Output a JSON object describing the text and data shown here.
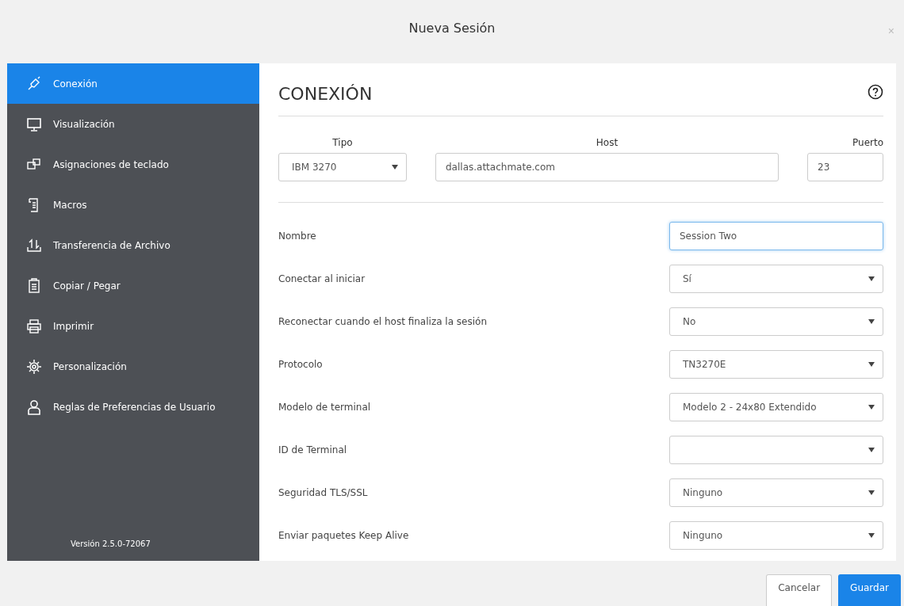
{
  "window": {
    "title": "Nueva Sesión",
    "close": "×"
  },
  "sidebar": {
    "items": [
      {
        "label": "Conexión",
        "selected": true
      },
      {
        "label": "Visualización",
        "selected": false
      },
      {
        "label": "Asignaciones de teclado",
        "selected": false
      },
      {
        "label": "Macros",
        "selected": false
      },
      {
        "label": "Transferencia de Archivo",
        "selected": false
      },
      {
        "label": "Copiar / Pegar",
        "selected": false
      },
      {
        "label": "Imprimir",
        "selected": false
      },
      {
        "label": "Personalización",
        "selected": false
      },
      {
        "label": "Reglas de Preferencias de Usuario",
        "selected": false
      }
    ],
    "version": "Versión 2.5.0-72067"
  },
  "section": {
    "title": "CONEXIÓN"
  },
  "connection": {
    "type": {
      "label": "Tipo",
      "value": "IBM 3270"
    },
    "host": {
      "label": "Host",
      "value": "dallas.attachmate.com"
    },
    "port": {
      "label": "Puerto",
      "value": "23"
    }
  },
  "settings": [
    {
      "kind": "text",
      "label": "Nombre",
      "value": "Session Two",
      "focused": true
    },
    {
      "kind": "select",
      "label": "Conectar al iniciar",
      "value": "Sí"
    },
    {
      "kind": "select",
      "label": "Reconectar cuando el host finaliza la sesión",
      "value": "No"
    },
    {
      "kind": "select",
      "label": "Protocolo",
      "value": "TN3270E"
    },
    {
      "kind": "select",
      "label": "Modelo de terminal",
      "value": "Modelo 2 - 24x80 Extendido"
    },
    {
      "kind": "select",
      "label": "ID de Terminal"
    },
    {
      "kind": "select",
      "label": "Seguridad TLS/SSL",
      "value": "Ninguno"
    },
    {
      "kind": "select",
      "label": "Enviar paquetes Keep Alive",
      "value": "Ninguno"
    }
  ],
  "buttons": [
    {
      "label": "Cancelar",
      "primary": false
    },
    {
      "label": "Guardar",
      "primary": true
    }
  ]
}
